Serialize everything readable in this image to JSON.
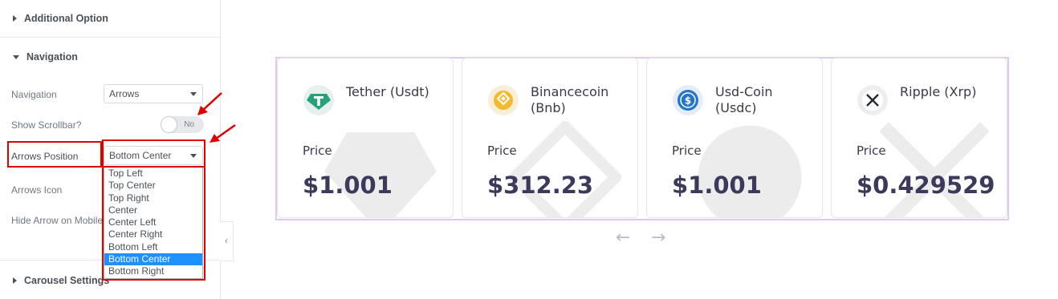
{
  "sections": {
    "additional_option": "Additional Option",
    "navigation": "Navigation",
    "carousel_settings": "Carousel Settings"
  },
  "controls": {
    "navigation_label": "Navigation",
    "navigation_value": "Arrows",
    "show_scrollbar_label": "Show Scrollbar?",
    "scrollbar_toggle": "No",
    "arrows_position_label": "Arrows Position",
    "arrows_position_value": "Bottom Center",
    "arrows_icon_label": "Arrows Icon",
    "hide_arrow_mobile_label": "Hide Arrow on Mobile"
  },
  "arrows_position_options": [
    "Top Left",
    "Top Center",
    "Top Right",
    "Center",
    "Center Left",
    "Center Right",
    "Bottom Left",
    "Bottom Center",
    "Bottom Right"
  ],
  "selected_option_index": 7,
  "cards": [
    {
      "name": "Tether (Usdt)",
      "price_label": "Price",
      "price": "$1.001",
      "icon": "tether-icon",
      "color": "#26a17b"
    },
    {
      "name": "Binancecoin (Bnb)",
      "price_label": "Price",
      "price": "$312.23",
      "icon": "bnb-icon",
      "color": "#f3ba2f"
    },
    {
      "name": "Usd-Coin (Usdc)",
      "price_label": "Price",
      "price": "$1.001",
      "icon": "usdc-icon",
      "color": "#2775ca"
    },
    {
      "name": "Ripple (Xrp)",
      "price_label": "Price",
      "price": "$0.429529",
      "icon": "xrp-icon",
      "color": "#23292f"
    }
  ],
  "carousel_arrows": {
    "prev": "←",
    "next": "→"
  },
  "colors": {
    "highlight": "#e00000",
    "selected_option": "#1e90ff",
    "carousel_border": "#e2c8ee"
  }
}
